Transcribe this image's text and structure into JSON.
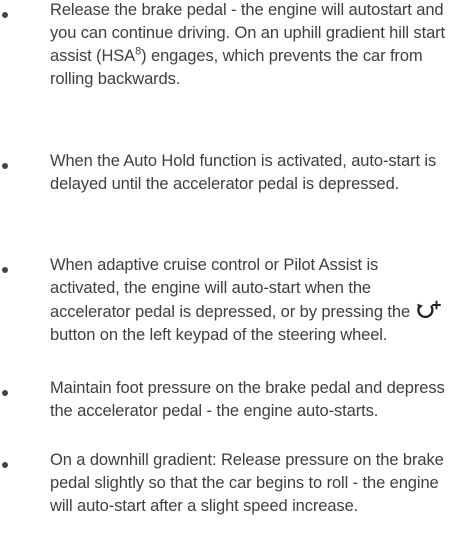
{
  "bullets": [
    {
      "text": "Release the brake pedal - the engine will autostart and you can continue driving. On an uphill gradient hill start assist (HSA",
      "superscript": "8",
      "text_after": ") engages, which prevents the car from rolling backwards."
    },
    {
      "text": "When the Auto Hold function is activated, auto-start is delayed until the accelerator pedal is depressed."
    },
    {
      "text_before_icon": "When adaptive cruise control or Pilot Assist is activated, the engine will auto-start when the accelerator pedal is depressed, or by pressing the",
      "icon": "start-stop-plus-icon",
      "text_after_icon": "button on the left keypad of the steering wheel."
    },
    {
      "text": "Maintain foot pressure on the brake pedal and depress the accelerator pedal - the engine auto-starts."
    },
    {
      "text": "On a downhill gradient: Release pressure on the brake pedal slightly so that the car begins to roll - the engine will auto-start after a slight speed increase."
    }
  ]
}
